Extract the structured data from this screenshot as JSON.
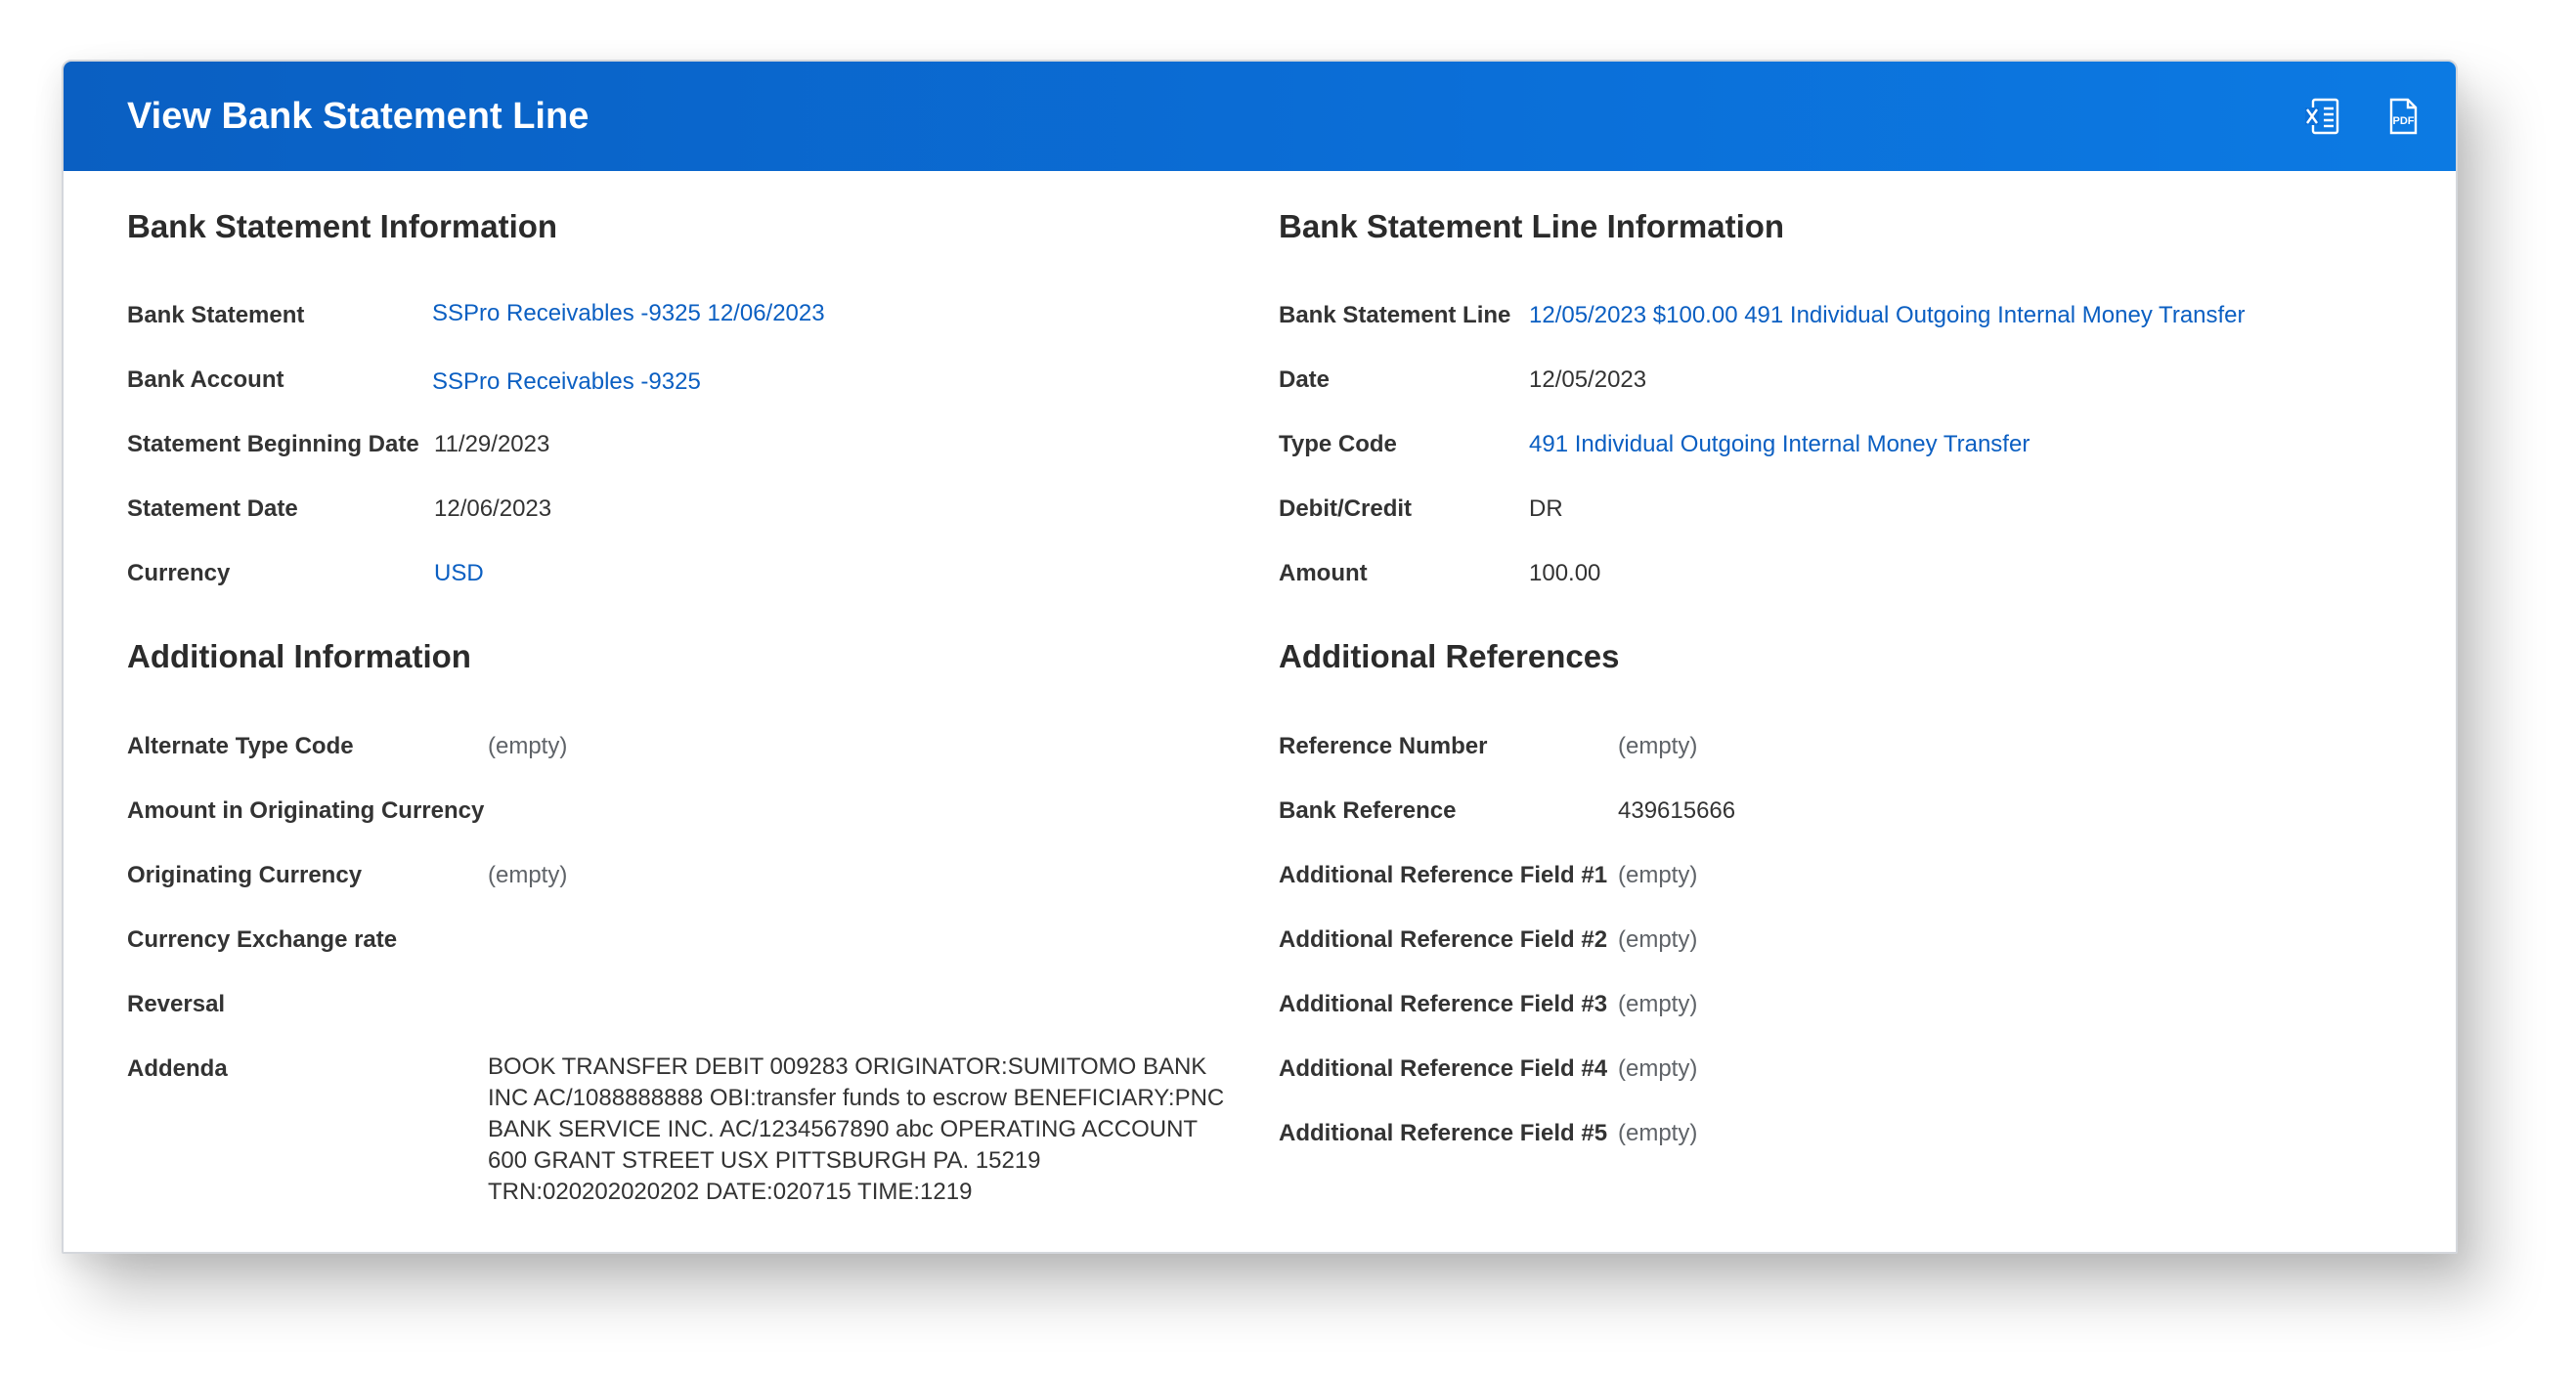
{
  "header": {
    "title": "View Bank Statement Line",
    "excel_icon": "export-excel-icon",
    "pdf_icon": "export-pdf-icon",
    "pdf_icon_text": "PDF"
  },
  "bank_statement_info": {
    "title": "Bank Statement Information",
    "fields": [
      {
        "label": "Bank Statement",
        "value": "SSPro Receivables -9325 12/06/2023"
      },
      {
        "label": "Bank Account",
        "value": "SSPro Receivables -9325"
      },
      {
        "label": "Statement Beginning Date",
        "value": "11/29/2023"
      },
      {
        "label": "Statement Date",
        "value": "12/06/2023"
      },
      {
        "label": "Currency",
        "value": "USD"
      }
    ]
  },
  "bank_statement_line_info": {
    "title": "Bank Statement Line Information",
    "fields": [
      {
        "label": "Bank Statement Line",
        "value": "12/05/2023 $100.00 491 Individual Outgoing Internal Money Transfer"
      },
      {
        "label": "Date",
        "value": "12/05/2023"
      },
      {
        "label": "Type Code",
        "value": "491 Individual Outgoing Internal Money Transfer"
      },
      {
        "label": "Debit/Credit",
        "value": "DR"
      },
      {
        "label": "Amount",
        "value": "100.00"
      }
    ]
  },
  "additional_info": {
    "title": "Additional Information",
    "fields": [
      {
        "label": "Alternate Type Code",
        "value": "(empty)"
      },
      {
        "label": "Amount in Originating Currency",
        "value": ""
      },
      {
        "label": "Originating Currency",
        "value": "(empty)"
      },
      {
        "label": "Currency Exchange rate",
        "value": ""
      },
      {
        "label": "Reversal",
        "value": ""
      },
      {
        "label": "Addenda",
        "value": "BOOK TRANSFER DEBIT 009283 ORIGINATOR:SUMITOMO BANK INC AC/1088888888 OBI:transfer funds to escrow BENEFICIARY:PNC BANK SERVICE INC. AC/1234567890 abc OPERATING ACCOUNT 600 GRANT STREET USX PITTSBURGH PA. 15219 TRN:020202020202 DATE:020715 TIME:1219"
      }
    ]
  },
  "additional_refs": {
    "title": "Additional References",
    "fields": [
      {
        "label": "Reference Number",
        "value": "(empty)"
      },
      {
        "label": "Bank Reference",
        "value": "439615666"
      },
      {
        "label": "Additional Reference Field #1",
        "value": "(empty)"
      },
      {
        "label": "Additional Reference Field #2",
        "value": "(empty)"
      },
      {
        "label": "Additional Reference Field #3",
        "value": "(empty)"
      },
      {
        "label": "Additional Reference Field #4",
        "value": "(empty)"
      },
      {
        "label": "Additional Reference Field #5",
        "value": "(empty)"
      }
    ]
  },
  "colors": {
    "header_blue": "#0b6fd8",
    "link_blue": "#0b5fc2",
    "text": "#333333",
    "empty_text": "#5f6368"
  }
}
